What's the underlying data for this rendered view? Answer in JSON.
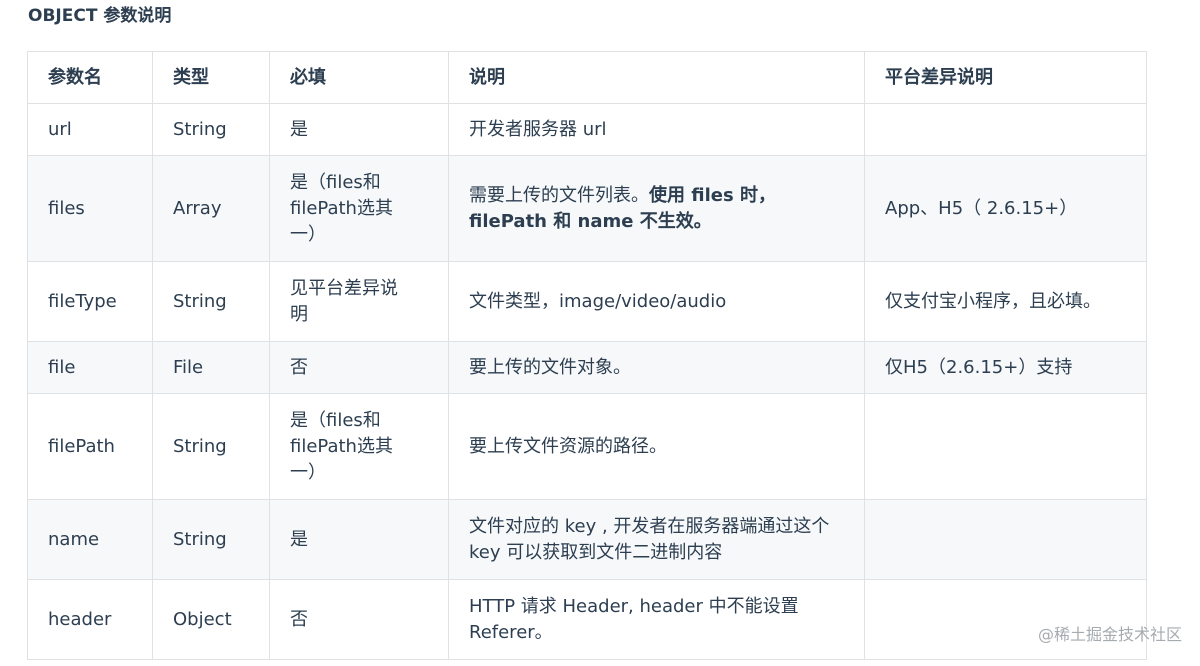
{
  "title": "OBJECT 参数说明",
  "columns": [
    "参数名",
    "类型",
    "必填",
    "说明",
    "平台差异说明"
  ],
  "rows": [
    {
      "name": "url",
      "type": "String",
      "required": "是",
      "desc": "开发者服务器 url",
      "desc_bold": "",
      "platform": ""
    },
    {
      "name": "files",
      "type": "Array",
      "required": "是（files和filePath选其一）",
      "desc": "需要上传的文件列表。",
      "desc_bold": "使用 files 时，filePath 和 name 不生效。",
      "platform": "App、H5（ 2.6.15+）"
    },
    {
      "name": "fileType",
      "type": "String",
      "required": "见平台差异说明",
      "desc": "文件类型，image/video/audio",
      "desc_bold": "",
      "platform": "仅支付宝小程序，且必填。"
    },
    {
      "name": "file",
      "type": "File",
      "required": "否",
      "desc": "要上传的文件对象。",
      "desc_bold": "",
      "platform": "仅H5（2.6.15+）支持"
    },
    {
      "name": "filePath",
      "type": "String",
      "required": "是（files和filePath选其一）",
      "desc": "要上传文件资源的路径。",
      "desc_bold": "",
      "platform": ""
    },
    {
      "name": "name",
      "type": "String",
      "required": "是",
      "desc": "文件对应的 key , 开发者在服务器端通过这个 key 可以获取到文件二进制内容",
      "desc_bold": "",
      "platform": ""
    },
    {
      "name": "header",
      "type": "Object",
      "required": "否",
      "desc": "HTTP 请求 Header, header 中不能设置 Referer。",
      "desc_bold": "",
      "platform": ""
    }
  ],
  "watermark": "@稀土掘金技术社区"
}
